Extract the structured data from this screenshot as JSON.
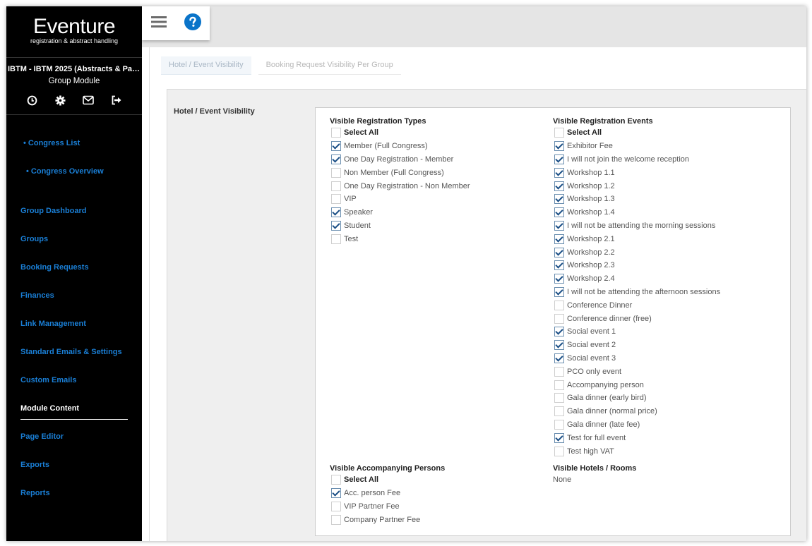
{
  "brand": {
    "name": "Eventure",
    "tagline": "registration & abstract handling"
  },
  "congress": {
    "name": "IBTM - IBTM 2025 (Abstracts & Par…",
    "module": "Group Module"
  },
  "sidebar_icons": [
    "clock-icon",
    "gear-icon",
    "envelope-icon",
    "sign-out-icon"
  ],
  "nav": {
    "congress_list": "• Congress List",
    "congress_overview": "• Congress Overview",
    "group_dashboard": "Group Dashboard",
    "groups": "Groups",
    "booking_requests": "Booking Requests",
    "finances": "Finances",
    "link_management": "Link Management",
    "standard_emails": "Standard Emails & Settings",
    "custom_emails": "Custom Emails",
    "module_content": "Module Content",
    "page_editor": "Page Editor",
    "exports": "Exports",
    "reports": "Reports"
  },
  "topbar": {
    "menu_icon": "hamburger-menu-icon",
    "help_icon": "help-circle-icon"
  },
  "tabs": [
    {
      "label": "Hotel / Event Visibility",
      "active": true
    },
    {
      "label": "Booking Request Visibility Per Group",
      "active": false
    }
  ],
  "panel": {
    "label": "Hotel / Event Visibility"
  },
  "registration_types": {
    "title": "Visible Registration Types",
    "select_all": "Select All",
    "items": [
      {
        "label": "Member (Full Congress)",
        "checked": true
      },
      {
        "label": "One Day Registration - Member",
        "checked": true
      },
      {
        "label": "Non Member (Full Congress)",
        "checked": false
      },
      {
        "label": "One Day Registration - Non Member",
        "checked": false
      },
      {
        "label": "VIP",
        "checked": false
      },
      {
        "label": "Speaker",
        "checked": true
      },
      {
        "label": "Student",
        "checked": true
      },
      {
        "label": "Test",
        "checked": false
      }
    ]
  },
  "registration_events": {
    "title": "Visible Registration Events",
    "select_all": "Select All",
    "items": [
      {
        "label": "Exhibitor Fee",
        "checked": true
      },
      {
        "label": "I will not join the welcome reception",
        "checked": true
      },
      {
        "label": "Workshop 1.1",
        "checked": true
      },
      {
        "label": "Workshop 1.2",
        "checked": true
      },
      {
        "label": "Workshop 1.3",
        "checked": true
      },
      {
        "label": "Workshop 1.4",
        "checked": true
      },
      {
        "label": "I will not be attending the morning sessions",
        "checked": true
      },
      {
        "label": "Workshop 2.1",
        "checked": true
      },
      {
        "label": "Workshop 2.2",
        "checked": true
      },
      {
        "label": "Workshop 2.3",
        "checked": true
      },
      {
        "label": "Workshop 2.4",
        "checked": true
      },
      {
        "label": "I will not be attending the afternoon sessions",
        "checked": true
      },
      {
        "label": "Conference Dinner",
        "checked": false
      },
      {
        "label": "Conference dinner (free)",
        "checked": false
      },
      {
        "label": "Social event 1",
        "checked": true
      },
      {
        "label": "Social event 2",
        "checked": true
      },
      {
        "label": "Social event 3",
        "checked": true
      },
      {
        "label": "PCO only event",
        "checked": false
      },
      {
        "label": "Accompanying person",
        "checked": false
      },
      {
        "label": "Gala dinner (early bird)",
        "checked": false
      },
      {
        "label": "Gala dinner (normal price)",
        "checked": false
      },
      {
        "label": "Gala dinner (late fee)",
        "checked": false
      },
      {
        "label": "Test for full event",
        "checked": true
      },
      {
        "label": "Test high VAT",
        "checked": false
      }
    ]
  },
  "accompanying_persons": {
    "title": "Visible Accompanying Persons",
    "select_all": "Select All",
    "items": [
      {
        "label": "Acc. person Fee",
        "checked": true
      },
      {
        "label": "VIP Partner Fee",
        "checked": false
      },
      {
        "label": "Company Partner Fee",
        "checked": false
      }
    ]
  },
  "hotels_rooms": {
    "title": "Visible Hotels / Rooms",
    "value": "None"
  }
}
